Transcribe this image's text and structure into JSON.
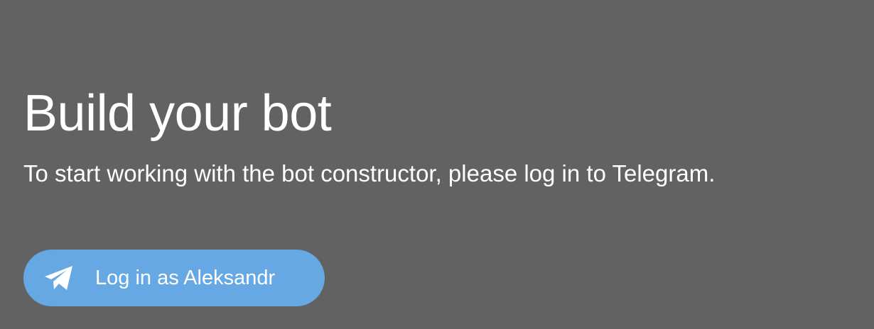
{
  "hero": {
    "title": "Build your bot",
    "subtitle": "To start working with the bot constructor, please log in to Telegram."
  },
  "login": {
    "label": "Log in as Aleksandr",
    "icon": "telegram-plane-icon"
  },
  "colors": {
    "background": "#626262",
    "button": "#65a8e3",
    "text": "#ffffff"
  }
}
